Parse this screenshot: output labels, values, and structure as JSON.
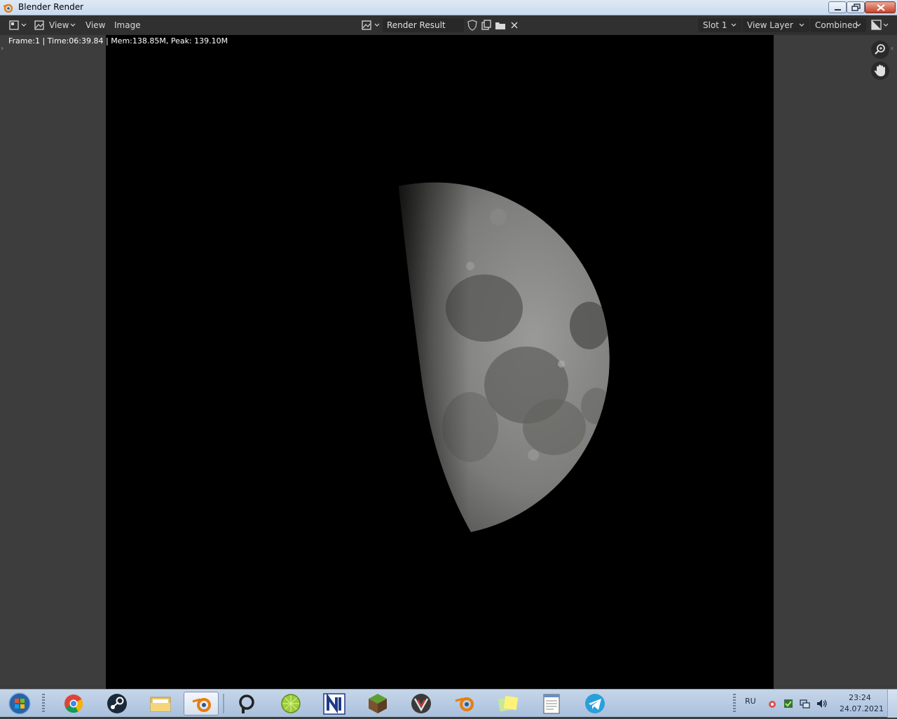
{
  "window": {
    "title": "Blender Render"
  },
  "header": {
    "menus": [
      "View",
      "View",
      "Image"
    ],
    "image_name": "Render Result",
    "slot": "Slot 1",
    "view_layer": "View Layer",
    "pass": "Combined"
  },
  "viewport": {
    "stats": "Frame:1 | Time:06:39.84 | Mem:138.85M, Peak: 139.10M"
  },
  "taskbar": {
    "apps": [
      "start-orb",
      "chrome-icon",
      "steam-icon",
      "explorer-icon",
      "blender-icon",
      "search-app-icon",
      "lime-icon",
      "n-app-icon",
      "minecraft-icon",
      "vector-icon",
      "blender-icon",
      "sticky-notes-icon",
      "notepad-icon",
      "telegram-icon"
    ],
    "language": "RU",
    "time": "23:24",
    "date": "24.07.2021"
  },
  "colors": {
    "header_bg": "#303030",
    "viewport_bg": "#3d3d3d",
    "render_bg": "#000000",
    "blender_orange": "#e87d0d",
    "telegram_blue": "#2aa0da"
  }
}
